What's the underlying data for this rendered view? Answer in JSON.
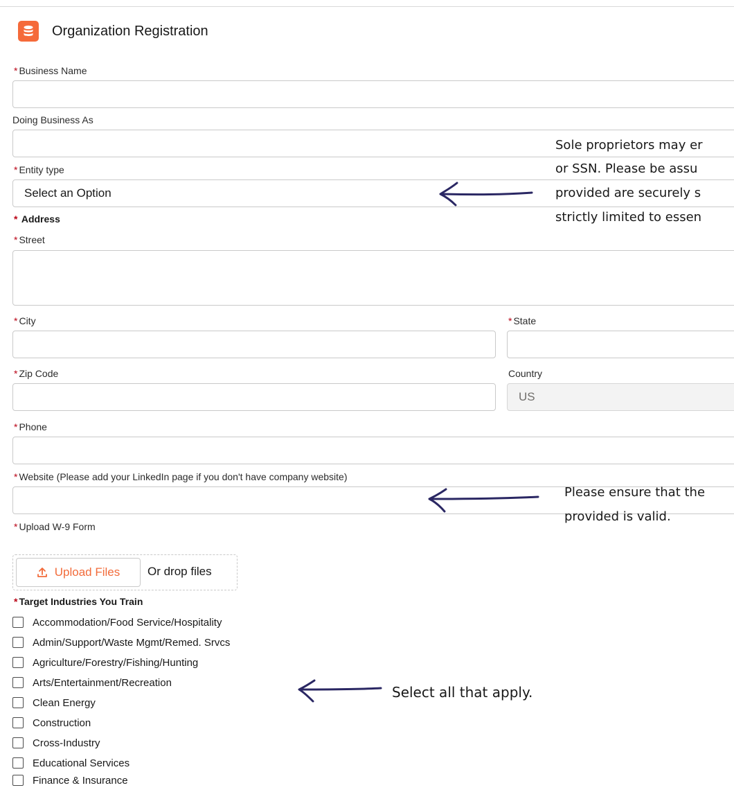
{
  "header": {
    "title": "Organization Registration",
    "icon": "database-icon",
    "icon_color": "#f56a3a"
  },
  "form": {
    "business_name": {
      "label": "Business Name",
      "required": true,
      "value": ""
    },
    "dba": {
      "label": "Doing Business As",
      "required": false,
      "value": ""
    },
    "entity_type": {
      "label": "Entity type",
      "required": true,
      "value": "Select an Option"
    },
    "address": {
      "label": "Address",
      "required": true
    },
    "street": {
      "label": "Street",
      "required": true,
      "value": ""
    },
    "city": {
      "label": "City",
      "required": true,
      "value": ""
    },
    "state": {
      "label": "State",
      "required": true,
      "value": ""
    },
    "zip": {
      "label": "Zip Code",
      "required": true,
      "value": ""
    },
    "country": {
      "label": "Country",
      "required": false,
      "value": "US"
    },
    "phone": {
      "label": "Phone",
      "required": true,
      "value": ""
    },
    "website": {
      "label": "Website (Please add your LinkedIn page if you don't have company website)",
      "required": true,
      "value": ""
    },
    "w9": {
      "label": "Upload W-9 Form",
      "required": true,
      "upload_label": "Upload Files",
      "drop_label": "Or drop files"
    },
    "industries": {
      "label": "Target Industries You Train",
      "required": true,
      "options": [
        "Accommodation/Food Service/Hospitality",
        "Admin/Support/Waste Mgmt/Remed. Srvcs",
        "Agriculture/Forestry/Fishing/Hunting",
        "Arts/Entertainment/Recreation",
        "Clean Energy",
        "Construction",
        "Cross-Industry",
        "Educational Services",
        "Finance & Insurance"
      ]
    }
  },
  "annotations": {
    "entity_note": [
      "Sole proprietors may er",
      "or SSN. Please be assu",
      "provided are securely s",
      "strictly limited to essen"
    ],
    "website_note": [
      "Please ensure that the",
      "provided is valid."
    ],
    "industries_note": "Select all that apply."
  },
  "colors": {
    "required_asterisk": "#ba0517",
    "accent_orange": "#f26b3a",
    "arrow": "#2a2763"
  }
}
